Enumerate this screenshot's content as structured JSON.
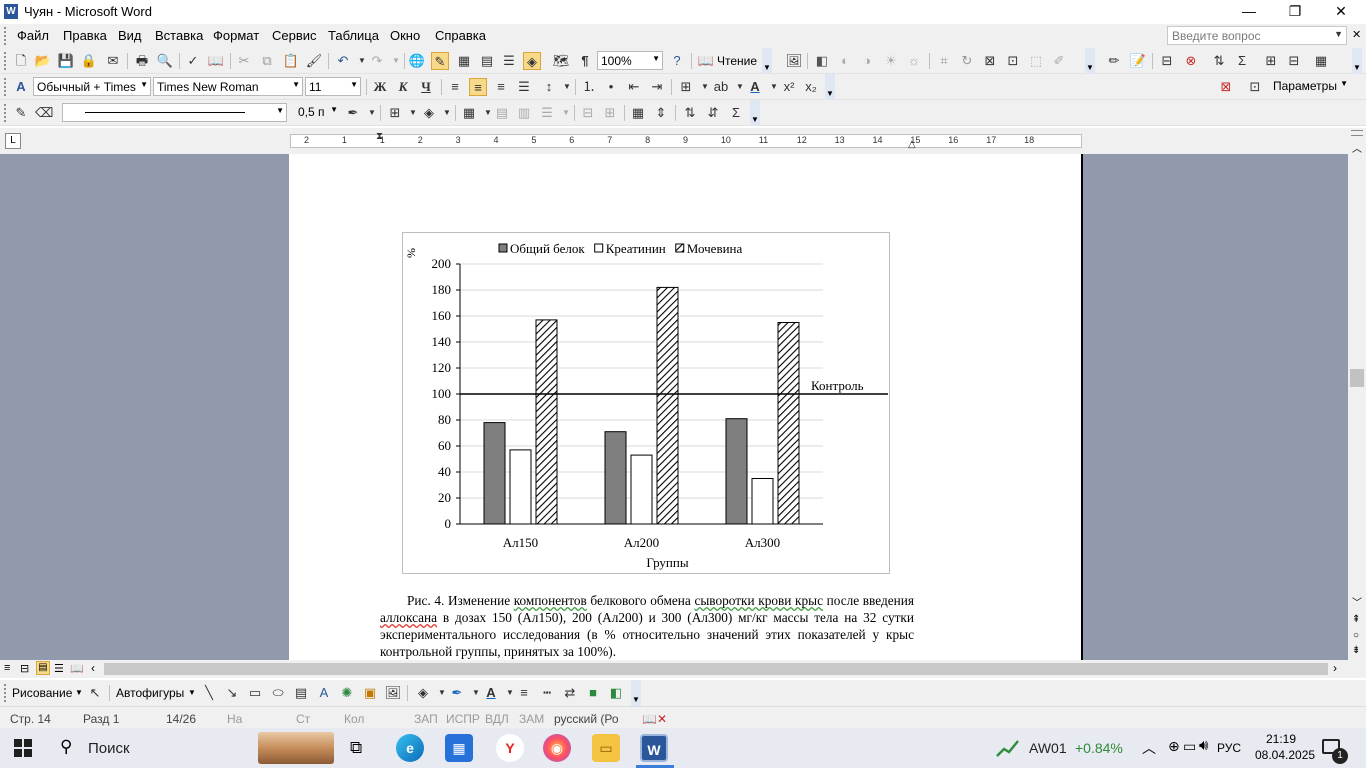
{
  "window": {
    "title": "Чуян - Microsoft Word",
    "min_icon": "minimize-icon",
    "max_icon": "restore-icon",
    "close_icon": "close-icon"
  },
  "menu": {
    "items": [
      "Файл",
      "Правка",
      "Вид",
      "Вставка",
      "Формат",
      "Сервис",
      "Таблица",
      "Окно",
      "Справка"
    ],
    "help_placeholder": "Введите вопрос"
  },
  "standard_toolbar": {
    "zoom": "100%",
    "reading_label": "Чтение"
  },
  "format_toolbar": {
    "style": "Обычный + Times",
    "font": "Times New Roman",
    "size": "11",
    "bold": "Ж",
    "italic": "К",
    "underline": "Ч",
    "params_label": "Параметры"
  },
  "tables_toolbar": {
    "line_weight": "0,5 п"
  },
  "ruler": {
    "numbers": [
      "2",
      "1",
      "1",
      "2",
      "3",
      "4",
      "5",
      "6",
      "7",
      "8",
      "9",
      "10",
      "11",
      "12",
      "13",
      "14",
      "15",
      "16",
      "17",
      "18"
    ]
  },
  "chart_data": {
    "type": "bar",
    "categories": [
      "Ал150",
      "Ал200",
      "Ал300"
    ],
    "series": [
      {
        "name": "Общий белок",
        "values": [
          78,
          71,
          81
        ],
        "fill": "#7f7f7f"
      },
      {
        "name": "Креатинин",
        "values": [
          57,
          53,
          35
        ],
        "fill": "#ffffff"
      },
      {
        "name": "Мочевина",
        "values": [
          157,
          182,
          155
        ],
        "fill": "hatch"
      }
    ],
    "ylabel": "%",
    "xlabel": "Группы",
    "ylim": [
      0,
      200
    ],
    "yticks": [
      0,
      20,
      40,
      60,
      80,
      100,
      120,
      140,
      160,
      180,
      200
    ],
    "reference_line": {
      "value": 100,
      "label": "Контроль"
    },
    "grid": true,
    "legend": "top"
  },
  "caption": {
    "lead": "Рис. 4. Изменение ",
    "w_components": "компонентов",
    "mid1": " белкового обмена ",
    "w_serum": "сыворотки крови крыс",
    "mid2": " после введения ",
    "w_alloxan": "аллоксана",
    "tail": " в дозах 150 (Ал150), 200 (Ал200) и 300 (Ал300) мг/кг массы тела на 32 сутки экспериментального исследования (в % относительно значений этих показателей у крыс контрольной группы, принятых за 100%)."
  },
  "drawing_toolbar": {
    "draw_label": "Рисование",
    "autoshapes_label": "Автофигуры"
  },
  "status": {
    "page": "Стр. 14",
    "section": "Разд 1",
    "pages": "14/26",
    "at": "На",
    "line": "Ст",
    "col": "Кол",
    "rec": "ЗАП",
    "trk": "ИСПР",
    "ext": "ВДЛ",
    "ovr": "ЗАМ",
    "lang": "русский (Ро"
  },
  "taskbar": {
    "search_label": "Поиск",
    "stock_name": "AW01",
    "stock_change": "+0.84%",
    "lang": "РУС",
    "time": "21:19",
    "date": "08.04.2025",
    "notif_count": "1",
    "accent": "#2e8b3a"
  }
}
